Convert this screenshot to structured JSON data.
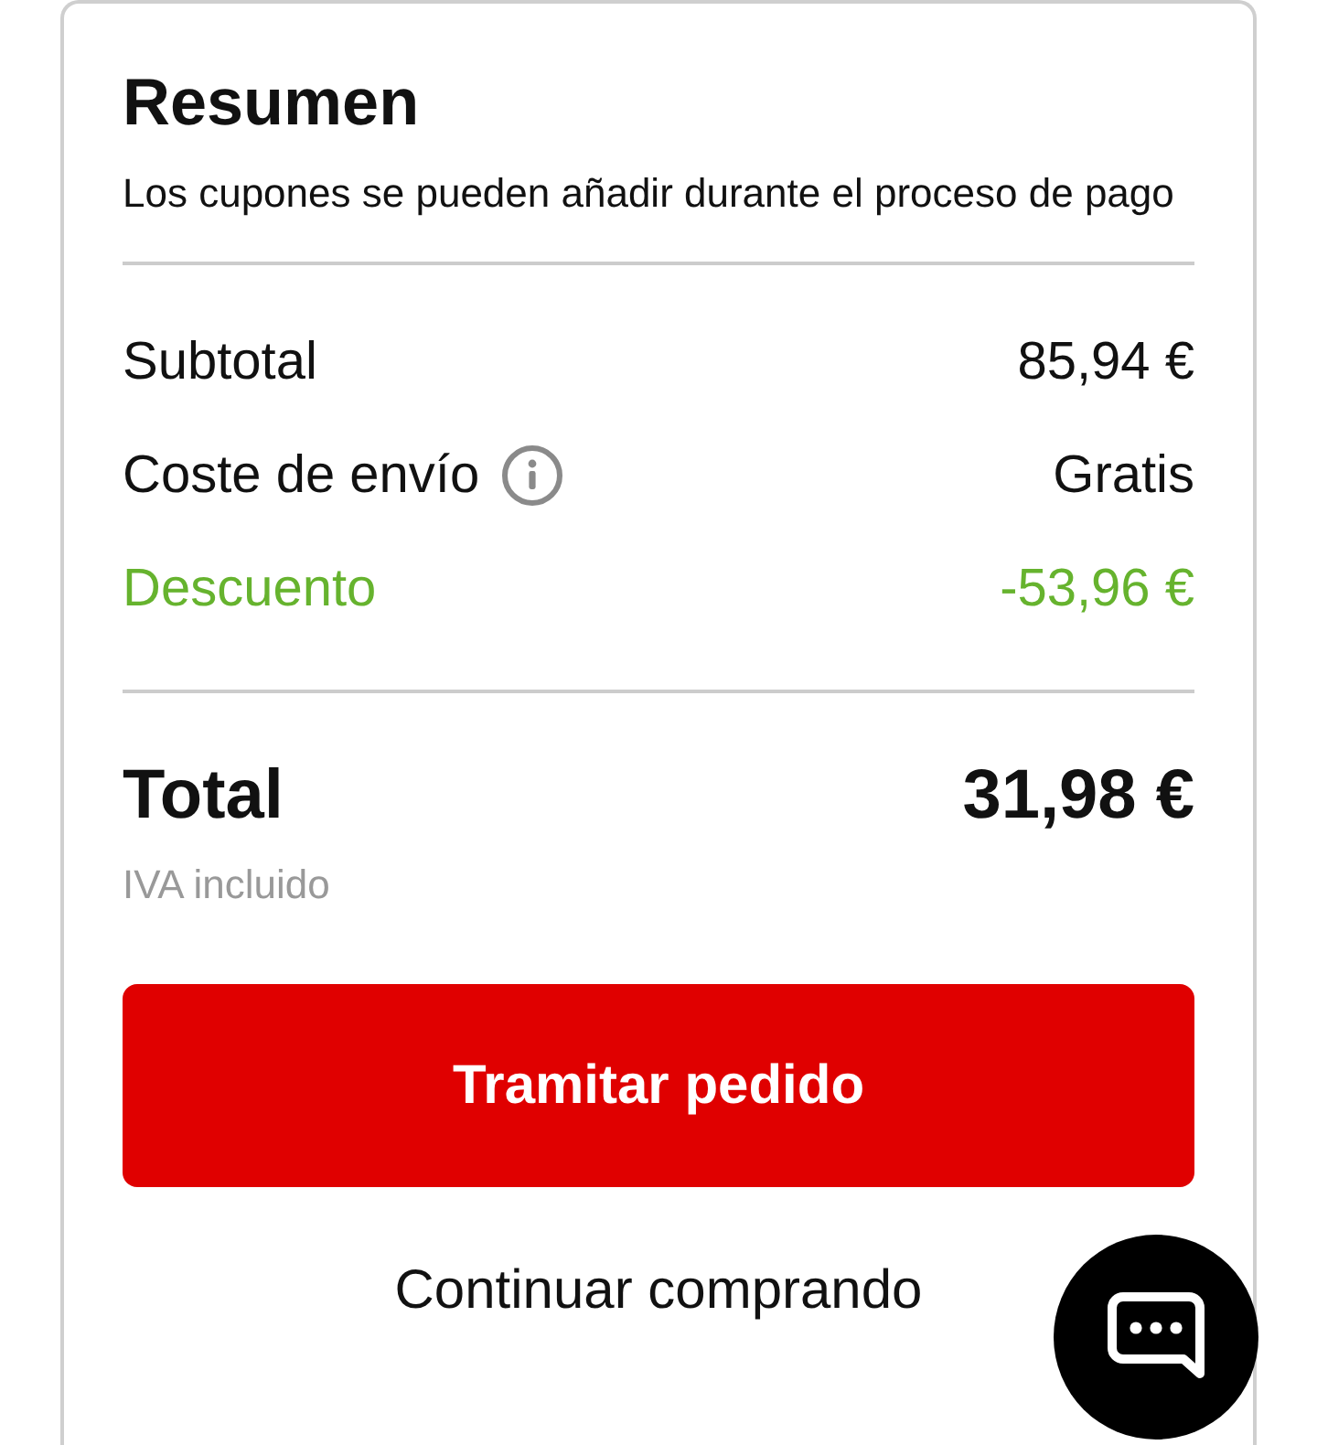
{
  "summary": {
    "title": "Resumen",
    "note": "Los cupones se pueden añadir durante el proceso de pago",
    "lines": [
      {
        "kind": "normal",
        "label": "Subtotal",
        "value": "85,94 €"
      },
      {
        "kind": "normal",
        "label": "Coste de envío",
        "value": "Gratis",
        "info": true
      },
      {
        "kind": "discount",
        "label": "Descuento",
        "value": "-53,96 €"
      }
    ],
    "total": {
      "label": "Total",
      "value": "31,98 €",
      "note": "IVA incluido"
    },
    "checkout_button": "Tramitar pedido",
    "continue_link": "Continuar comprando"
  }
}
